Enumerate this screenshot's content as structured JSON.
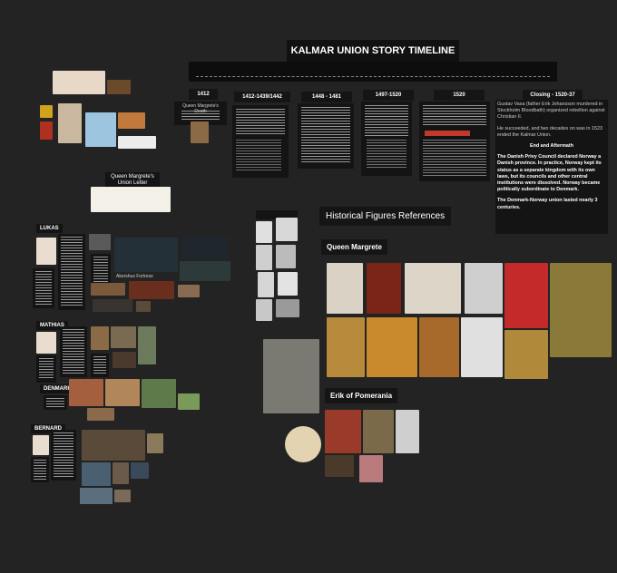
{
  "board": {
    "title": "KALMAR UNION STORY TIMELINE",
    "timeline": {
      "years": [
        "1412",
        "1412-1439/1442",
        "1448 - 1481",
        "1497-1520",
        "1520",
        "Closing - 1520-37"
      ],
      "col_1412_caption": "Queen Margrete's Death",
      "col_1520_lines": [
        "Gustav Vasa (father Erik Johansson murdered in Stockholm Bloodbath) organized rebellion against Christian II.",
        "He succeeded, and two decades on was in 1523 ended the Kalmar Union."
      ],
      "closing": {
        "heading": "End and Aftermath",
        "body": "The Danish Privy Council declared Norway a Danish province. In practice, Norway kept its status as a separate kingdom with its own laws, but its councils and other central institutions were dissolved. Norway became politically subordinate to Denmark.",
        "final": "The Denmark-Norway union lasted nearly 3 centuries."
      }
    },
    "left_panel": {
      "union_letter_label": "Queen Margrete's Union Letter",
      "rows": [
        "LUKAS",
        "MATHIAS",
        "DENMARK",
        "BERNARD"
      ],
      "fortress_label": "Akershus Fortress"
    },
    "references": {
      "section_title": "Historical Figures References",
      "queen_title": "Queen Margrete",
      "erik_title": "Erik of Pomerania"
    }
  },
  "colors": {
    "background": "#232323",
    "card": "#141414",
    "accent_red": "#c0392b",
    "gold": "#b88a3c"
  }
}
